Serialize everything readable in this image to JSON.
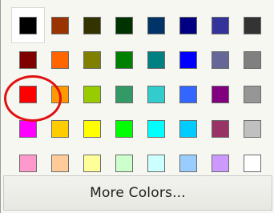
{
  "palette": {
    "rows": [
      [
        "#000000",
        "#993300",
        "#333300",
        "#003300",
        "#003366",
        "#000080",
        "#333399",
        "#333333"
      ],
      [
        "#800000",
        "#FF6600",
        "#808000",
        "#008000",
        "#008080",
        "#0000FF",
        "#666699",
        "#808080"
      ],
      [
        "#FF0000",
        "#FF9900",
        "#99CC00",
        "#339966",
        "#33CCCC",
        "#3366FF",
        "#800080",
        "#969696"
      ],
      [
        "#FF00FF",
        "#FFCC00",
        "#FFFF00",
        "#00FF00",
        "#00FFFF",
        "#00CCFF",
        "#993366",
        "#C0C0C0"
      ],
      [
        "#FF99CC",
        "#FFCC99",
        "#FFFF99",
        "#CCFFCC",
        "#CCFFFF",
        "#99CCFF",
        "#CC99FF",
        "#FFFFFF"
      ]
    ],
    "selected": {
      "row": 0,
      "col": 0
    },
    "highlighted": {
      "row": 2,
      "col": 0,
      "color": "#e11111"
    }
  },
  "more_colors_label": "More Colors..."
}
